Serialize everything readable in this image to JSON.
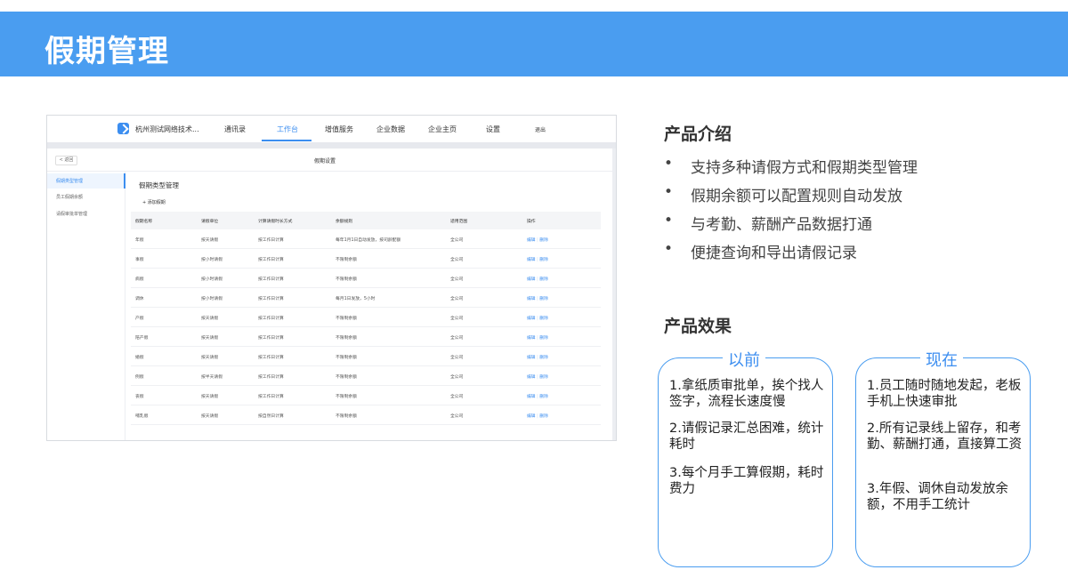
{
  "banner": {
    "title": "假期管理"
  },
  "screenshot": {
    "company": "杭州测试网络技术...",
    "nav": [
      "通讯录",
      "工作台",
      "增值服务",
      "企业数据",
      "企业主页",
      "设置"
    ],
    "active_nav": "工作台",
    "logout": "退出",
    "back_label": "< 返回",
    "page_title": "假期设置",
    "sidebar": [
      "假期类型管理",
      "员工假期余额",
      "请假审批单管理"
    ],
    "section_title": "假期类型管理",
    "add_button": "+ 添加假期",
    "table": {
      "headers": [
        "假期名称",
        "请假单位",
        "计算请假时长方式",
        "余额规则",
        "适用范围",
        "操作"
      ],
      "rows": [
        [
          "年假",
          "按天请假",
          "按工作日计算",
          "每年1月1日自动发放，按司龄配额",
          "全公司"
        ],
        [
          "事假",
          "按小时请假",
          "按工作日计算",
          "不限制余额",
          "全公司"
        ],
        [
          "病假",
          "按小时请假",
          "按工作日计算",
          "不限制余额",
          "全公司"
        ],
        [
          "调休",
          "按小时请假",
          "按工作日计算",
          "每月1日发放，5小时",
          "全公司"
        ],
        [
          "产假",
          "按天请假",
          "按工作日计算",
          "不限制余额",
          "全公司"
        ],
        [
          "陪产假",
          "按天请假",
          "按工作日计算",
          "不限制余额",
          "全公司"
        ],
        [
          "婚假",
          "按天请假",
          "按工作日计算",
          "不限制余额",
          "全公司"
        ],
        [
          "例假",
          "按半天请假",
          "按工作日计算",
          "不限制余额",
          "全公司"
        ],
        [
          "丧假",
          "按天请假",
          "按工作日计算",
          "不限制余额",
          "全公司"
        ],
        [
          "哺乳假",
          "按天请假",
          "按自然日计算",
          "不限制余额",
          "全公司"
        ]
      ],
      "edit_label": "编辑",
      "delete_label": "删除"
    }
  },
  "intro": {
    "title": "产品介绍",
    "bullet_symbol": "•",
    "bullets": [
      "支持多种请假方式和假期类型管理",
      "假期余额可以配置规则自动发放",
      "与考勤、薪酬产品数据打通",
      "便捷查询和导出请假记录"
    ]
  },
  "effect": {
    "title": "产品效果",
    "before": {
      "label": "以前",
      "items": [
        "1.拿纸质审批单，挨个找人签字，流程长速度慢",
        "2.请假记录汇总困难，统计耗时",
        "3.每个月手工算假期，耗时费力"
      ]
    },
    "after": {
      "label": "现在",
      "items": [
        "1.员工随时随地发起，老板手机上快速审批",
        "2.所有记录线上留存，和考勤、薪酬打通，直接算工资",
        "3.年假、调休自动发放余额，不用手工统计"
      ]
    }
  },
  "colors": {
    "brand": "#4a9df0",
    "accent": "#3c8ef0"
  }
}
